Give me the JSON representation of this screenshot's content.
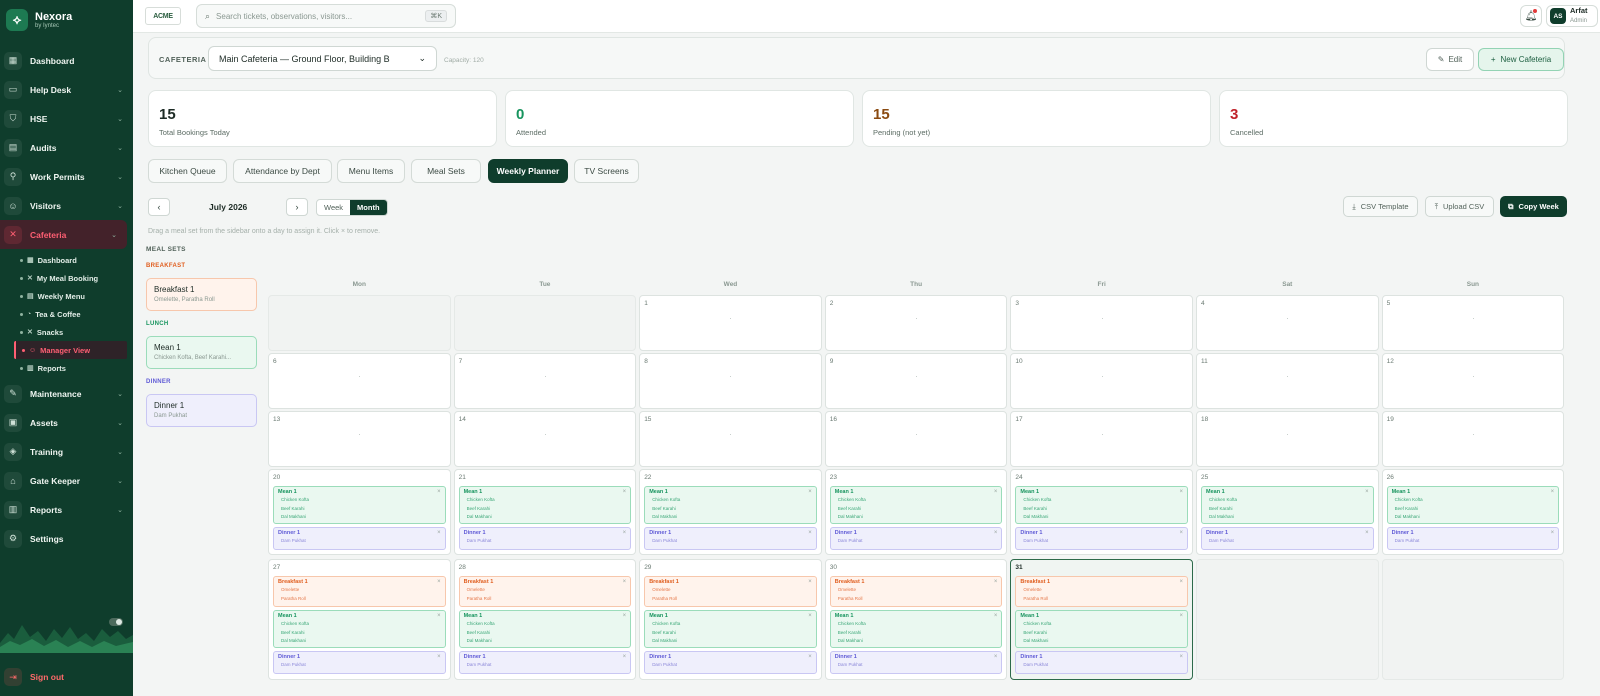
{
  "brand": {
    "name": "Nexora",
    "sub": "by Iyntec"
  },
  "sidebar": {
    "items": [
      {
        "key": "dashboard",
        "label": "Dashboard",
        "icon": "▦",
        "chev": false
      },
      {
        "key": "helpdesk",
        "label": "Help Desk",
        "icon": "▭",
        "chev": true
      },
      {
        "key": "hse",
        "label": "HSE",
        "icon": "⛉",
        "chev": true
      },
      {
        "key": "audits",
        "label": "Audits",
        "icon": "▤",
        "chev": true
      },
      {
        "key": "workpermits",
        "label": "Work Permits",
        "icon": "⚲",
        "chev": true
      },
      {
        "key": "visitors",
        "label": "Visitors",
        "icon": "☺",
        "chev": true
      },
      {
        "key": "cafeteria",
        "label": "Cafeteria",
        "icon": "✕",
        "chev": true,
        "active": true
      }
    ],
    "cafeteria_sub": [
      {
        "label": "Dashboard",
        "icon": "▦"
      },
      {
        "label": "My Meal Booking",
        "icon": "✕"
      },
      {
        "label": "Weekly Menu",
        "icon": "▤"
      },
      {
        "label": "Tea & Coffee",
        "icon": "◔"
      },
      {
        "label": "Snacks",
        "icon": "✕"
      },
      {
        "label": "Manager View",
        "icon": "☺",
        "active": true
      },
      {
        "label": "Reports",
        "icon": "▥"
      }
    ],
    "items_after": [
      {
        "key": "maintenance",
        "label": "Maintenance",
        "icon": "✎",
        "chev": true
      },
      {
        "key": "assets",
        "label": "Assets",
        "icon": "▣",
        "chev": true
      },
      {
        "key": "training",
        "label": "Training",
        "icon": "◈",
        "chev": true
      },
      {
        "key": "gatekeeper",
        "label": "Gate Keeper",
        "icon": "⌂",
        "chev": true
      },
      {
        "key": "reports",
        "label": "Reports",
        "icon": "▥",
        "chev": true
      },
      {
        "key": "settings",
        "label": "Settings",
        "icon": "⚙",
        "chev": false
      }
    ],
    "signout": "Sign out"
  },
  "topbar": {
    "logo": "ACME",
    "search_placeholder": "Search tickets, observations, visitors...",
    "shortcut": "⌘K",
    "user_initials": "AS",
    "user_name": "Arfat",
    "user_role": "Admin"
  },
  "cafeteria_bar": {
    "label": "CAFETERIA",
    "selected": "Main Cafeteria — Ground Floor, Building B",
    "capacity": "Capacity: 120",
    "edit": "Edit",
    "new": "New Cafeteria"
  },
  "stats": [
    {
      "value": "15",
      "label": "Total Bookings Today",
      "color": "#1d2b25"
    },
    {
      "value": "0",
      "label": "Attended",
      "color": "#17945e"
    },
    {
      "value": "15",
      "label": "Pending (not yet)",
      "color": "#8a4a10"
    },
    {
      "value": "3",
      "label": "Cancelled",
      "color": "#c0222a"
    }
  ],
  "tabs": [
    {
      "label": "Kitchen Queue"
    },
    {
      "label": "Attendance by Dept"
    },
    {
      "label": "Menu Items"
    },
    {
      "label": "Meal Sets"
    },
    {
      "label": "Weekly Planner",
      "active": true
    },
    {
      "label": "TV Screens"
    }
  ],
  "planner": {
    "month": "July 2026",
    "view_week": "Week",
    "view_month": "Month",
    "csv_template": "CSV Template",
    "upload_csv": "Upload CSV",
    "copy_week": "Copy Week",
    "hint": "Drag a meal set from the sidebar onto a day to assign it. Click × to remove."
  },
  "meal_sets": {
    "title": "MEAL SETS",
    "groups": [
      {
        "cat": "BREAKFAST",
        "type": "b",
        "name": "Breakfast 1",
        "desc": "Omelette, Paratha Roll"
      },
      {
        "cat": "LUNCH",
        "type": "l",
        "name": "Mean 1",
        "desc": "Chicken Kofta, Beef Karahi..."
      },
      {
        "cat": "DINNER",
        "type": "d",
        "name": "Dinner 1",
        "desc": "Dam Pukhat"
      }
    ]
  },
  "calendar": {
    "days_of_week": [
      "Mon",
      "Tue",
      "Wed",
      "Thu",
      "Fri",
      "Sat",
      "Sun"
    ],
    "today": 31,
    "weeks": [
      [
        null,
        null,
        1,
        2,
        3,
        4,
        5
      ],
      [
        6,
        7,
        8,
        9,
        10,
        11,
        12
      ],
      [
        13,
        14,
        15,
        16,
        17,
        18,
        19
      ],
      [
        20,
        21,
        22,
        23,
        24,
        25,
        26
      ],
      [
        27,
        28,
        29,
        30,
        31,
        null,
        null
      ]
    ],
    "meals": {
      "breakfast": {
        "name": "Breakfast 1",
        "items": [
          "Omelette",
          "Paratha Roll"
        ]
      },
      "lunch": {
        "name": "Mean 1",
        "items": [
          "Chicken Kofta",
          "Beef Karahi",
          "Dal Makhani"
        ]
      },
      "dinner": {
        "name": "Dinner 1",
        "items": [
          "Dam Pukhat"
        ]
      }
    },
    "assignments": {
      "20": [
        "lunch",
        "dinner"
      ],
      "21": [
        "lunch",
        "dinner"
      ],
      "22": [
        "lunch",
        "dinner"
      ],
      "23": [
        "lunch",
        "dinner"
      ],
      "24": [
        "lunch",
        "dinner"
      ],
      "25": [
        "lunch",
        "dinner"
      ],
      "26": [
        "lunch",
        "dinner"
      ],
      "27": [
        "breakfast",
        "lunch",
        "dinner"
      ],
      "28": [
        "breakfast",
        "lunch",
        "dinner"
      ],
      "29": [
        "breakfast",
        "lunch",
        "dinner"
      ],
      "30": [
        "breakfast",
        "lunch",
        "dinner"
      ],
      "31": [
        "breakfast",
        "lunch",
        "dinner"
      ]
    }
  }
}
